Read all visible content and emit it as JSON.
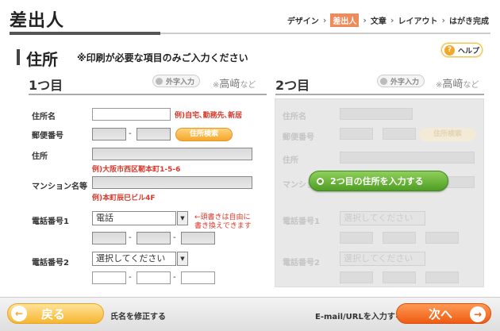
{
  "header": {
    "title": "差出人",
    "steps": [
      "デザイン",
      "差出人",
      "文章",
      "レイアウト",
      "はがき完成"
    ],
    "active_step": "差出人",
    "separator": "›"
  },
  "section": {
    "title": "住所",
    "note": "※印刷が必要な項目のみご入力ください",
    "help_label": "ヘルプ",
    "help_icon": "?"
  },
  "column1": {
    "heading": "1つ目",
    "gaiji_button": "外字入力",
    "gaiji_note_prefix": "※",
    "gaiji_note_char": "高﨑",
    "gaiji_note_suffix": "など",
    "fields": {
      "name_label": "住所名",
      "name_hint": "例)自宅､勤務先､新居",
      "postal_label": "郵便番号",
      "postal_search": "住所検索",
      "address_label": "住所",
      "address_hint": "例)大阪市西区靭本町1-5-6",
      "building_label": "マンション名等",
      "building_hint": "例)本町辰巳ビル4F",
      "phone1_label": "電話番号1",
      "phone1_select": "電話",
      "phone1_hint_line1": "←頭書きは自由に",
      "phone1_hint_line2": "書き換えできます",
      "phone2_label": "電話番号2",
      "phone2_select": "選択してください"
    },
    "dash": "-",
    "select_arrow": "▼"
  },
  "column2": {
    "heading": "2つ目",
    "gaiji_button": "外字入力",
    "gaiji_note_prefix": "※",
    "gaiji_note_char": "高﨑",
    "gaiji_note_suffix": "など",
    "fields": {
      "name_label": "住所名",
      "postal_label": "郵便番号",
      "postal_search": "住所検索",
      "address_label": "住所",
      "building_label": "マンション",
      "phone1_label": "電話番号1",
      "phone1_select": "選択してください",
      "phone2_label": "電話番号2",
      "phone2_select": "選択してください"
    },
    "enable_button": "2つ目の住所を入力する"
  },
  "footer": {
    "back_label": "戻る",
    "back_icon": "←",
    "left_text": "氏名を修正する",
    "right_text": "E-mail/URLを入力する",
    "next_label": "次へ",
    "next_icon": "→"
  },
  "colors": {
    "accent_orange": "#f08a5a",
    "hint_red": "#d8392b",
    "green": "#4f9e24"
  }
}
